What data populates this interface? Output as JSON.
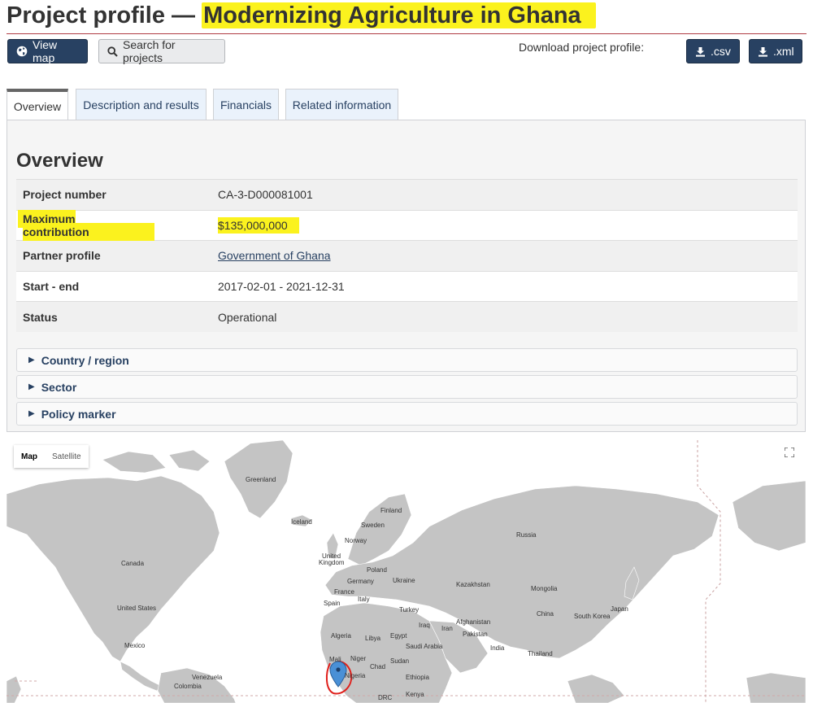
{
  "header": {
    "title_prefix": "Project profile — ",
    "title_project": "Modernizing Agriculture in Ghana"
  },
  "toolbar": {
    "view_map_label": "View map",
    "search_projects_label": "Search for projects",
    "download_label": "Download project profile:",
    "csv_label": ".csv",
    "xml_label": ".xml"
  },
  "tabs": [
    {
      "label": "Overview",
      "active": true
    },
    {
      "label": "Description and results",
      "active": false
    },
    {
      "label": "Financials",
      "active": false
    },
    {
      "label": "Related information",
      "active": false
    }
  ],
  "overview": {
    "heading": "Overview",
    "rows": [
      {
        "key": "Project number",
        "value": "CA-3-D000081001"
      },
      {
        "key": "Maximum contribution",
        "value": "$135,000,000"
      },
      {
        "key": "Partner profile",
        "value": "Government of Ghana"
      },
      {
        "key": "Start - end",
        "value": "2017-02-01 - 2021-12-31"
      },
      {
        "key": "Status",
        "value": "Operational"
      }
    ]
  },
  "details": [
    {
      "label": "Country / region"
    },
    {
      "label": "Sector"
    },
    {
      "label": "Policy marker"
    }
  ],
  "map": {
    "type_map": "Map",
    "type_satellite": "Satellite",
    "labels": {
      "greenland": "Greenland",
      "iceland": "Iceland",
      "finland": "Finland",
      "sweden": "Sweden",
      "norway": "Norway",
      "russia": "Russia",
      "canada": "Canada",
      "uk_1": "United",
      "uk_2": "Kingdom",
      "poland": "Poland",
      "germany": "Germany",
      "ukraine": "Ukraine",
      "france": "France",
      "kazakhstan": "Kazakhstan",
      "mongolia": "Mongolia",
      "italy": "Italy",
      "spain": "Spain",
      "united_states": "United States",
      "turkey": "Turkey",
      "china": "China",
      "japan": "Japan",
      "south_korea": "South Korea",
      "algeria": "Algeria",
      "libya": "Libya",
      "egypt": "Egypt",
      "iraq": "Iraq",
      "iran": "Iran",
      "afghanistan": "Afghanistan",
      "pakistan": "Pakistan",
      "saudi_arabia": "Saudi Arabia",
      "india": "India",
      "mexico": "Mexico",
      "mali": "Mali",
      "niger": "Niger",
      "chad": "Chad",
      "sudan": "Sudan",
      "thailand": "Thailand",
      "nigeria": "Nigeria",
      "ethiopia": "Ethiopia",
      "venezuela": "Venezuela",
      "colombia": "Colombia",
      "drc": "DRC",
      "kenya": "Kenya"
    },
    "land_color": "#c4c4c4",
    "water_color": "#ffffff",
    "marker_color": "#4a90d6",
    "annotation_color": "#e0201c"
  },
  "colors": {
    "primary": "#284162",
    "highlight": "#fbf21e",
    "rule": "#af3c43"
  }
}
